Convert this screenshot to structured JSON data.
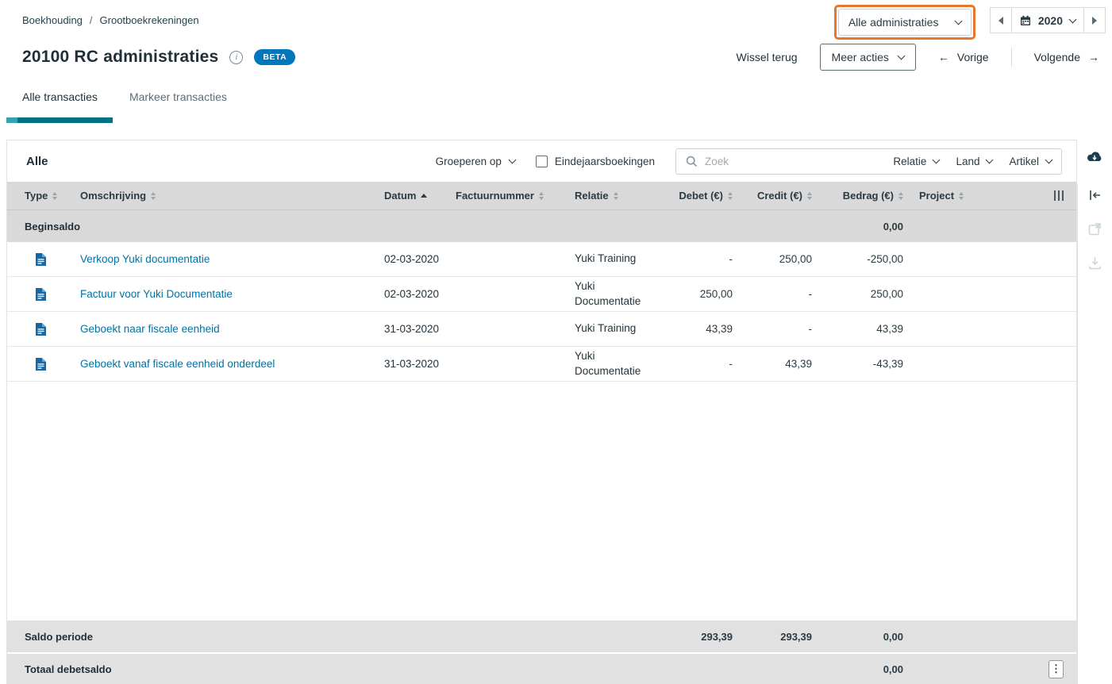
{
  "colors": {
    "accent_teal": "#037183",
    "link_blue": "#0072a3",
    "beta_blue": "#0076bd",
    "highlight_orange": "#e8772e",
    "header_gray": "#d9d9d9",
    "footer_gray": "#e1e1e1"
  },
  "icons": {
    "arrow_left": "←",
    "arrow_right": "→",
    "kebab": "⋮",
    "info": "i"
  },
  "breadcrumb": {
    "separator": "/",
    "items": [
      {
        "label": "Boekhouding"
      },
      {
        "label": "Grootboekrekeningen"
      }
    ]
  },
  "topbar": {
    "administration_selector": "Alle administraties",
    "year": "2020"
  },
  "header": {
    "title": "20100 RC administraties",
    "beta_badge": "BETA",
    "wissel_terug": "Wissel terug",
    "meer_acties": "Meer acties",
    "vorige": "Vorige",
    "volgende": "Volgende"
  },
  "tabs": [
    {
      "label": "Alle transacties",
      "active": true
    },
    {
      "label": "Markeer transacties",
      "active": false
    }
  ],
  "filterbar": {
    "group_title": "Alle",
    "groeperen_op": "Groeperen op",
    "eindejaarsboekingen": "Eindejaarsboekingen",
    "search_placeholder": "Zoek",
    "relatie": "Relatie",
    "land": "Land",
    "artikel": "Artikel"
  },
  "table": {
    "columns": {
      "type": "Type",
      "omschrijving": "Omschrijving",
      "datum": "Datum",
      "factuurnummer": "Factuurnummer",
      "relatie": "Relatie",
      "debet": "Debet (€)",
      "credit": "Credit (€)",
      "bedrag": "Bedrag (€)",
      "project": "Project"
    },
    "beginsaldo": {
      "label": "Beginsaldo",
      "bedrag": "0,00"
    },
    "rows": [
      {
        "omschrijving": "Verkoop Yuki documentatie",
        "datum": "02-03-2020",
        "factuurnummer": "",
        "relatie": "Yuki Training",
        "debet": "-",
        "credit": "250,00",
        "bedrag": "-250,00",
        "project": ""
      },
      {
        "omschrijving": "Factuur voor Yuki Documentatie",
        "datum": "02-03-2020",
        "factuurnummer": "",
        "relatie": "Yuki Documentatie",
        "debet": "250,00",
        "credit": "-",
        "bedrag": "250,00",
        "project": ""
      },
      {
        "omschrijving": "Geboekt naar fiscale eenheid",
        "datum": "31-03-2020",
        "factuurnummer": "",
        "relatie": "Yuki Training",
        "debet": "43,39",
        "credit": "-",
        "bedrag": "43,39",
        "project": ""
      },
      {
        "omschrijving": "Geboekt vanaf fiscale eenheid onderdeel",
        "datum": "31-03-2020",
        "factuurnummer": "",
        "relatie": "Yuki Documentatie",
        "debet": "-",
        "credit": "43,39",
        "bedrag": "-43,39",
        "project": ""
      }
    ],
    "footer": {
      "saldo_periode": {
        "label": "Saldo periode",
        "debet": "293,39",
        "credit": "293,39",
        "bedrag": "0,00"
      },
      "totaal_debetsaldo": {
        "label": "Totaal debetsaldo",
        "bedrag": "0,00"
      }
    }
  }
}
